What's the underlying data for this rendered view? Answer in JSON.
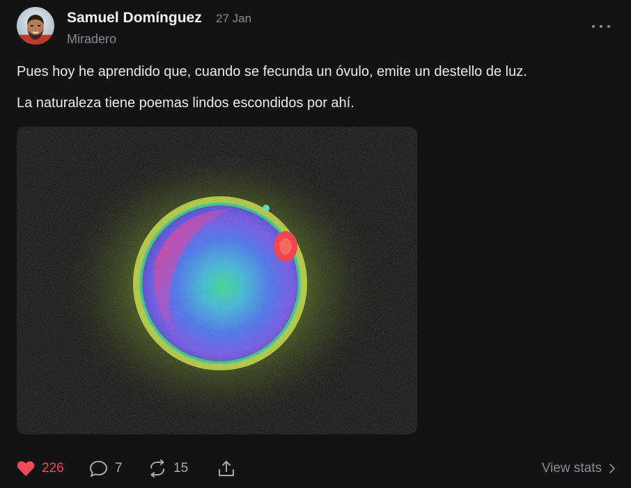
{
  "post": {
    "author": "Samuel Domínguez",
    "date": "27 Jan",
    "publication": "Miradero",
    "paragraphs": [
      "Pues hoy he aprendido que, cuando se fecunda un óvulo, emite un destello de luz.",
      "La naturaleza tiene poemas lindos escondidos por ahí."
    ]
  },
  "actions": {
    "likes": "226",
    "comments": "7",
    "restacks": "15",
    "view_stats": "View stats"
  },
  "icons": {
    "avatar": "avatar",
    "more": "more-horizontal-icon",
    "like": "heart-icon",
    "comment": "comment-bubble-icon",
    "restack": "restack-arrows-icon",
    "share": "share-upload-icon",
    "chevron": "chevron-right-icon"
  },
  "colors": {
    "background": "#131316",
    "like_active": "#ef4a57",
    "text_primary": "#ececef",
    "text_muted": "#8a8a92"
  }
}
